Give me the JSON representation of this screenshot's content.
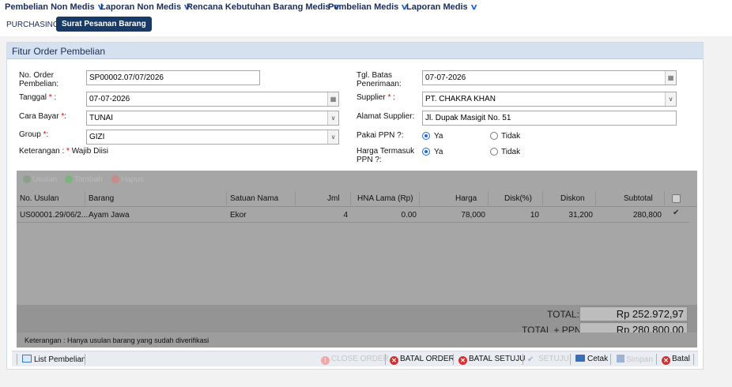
{
  "menu": [
    {
      "label": "Pembelian Non Medis"
    },
    {
      "label": "Laporan Non Medis"
    },
    {
      "label": "Rencana Kebutuhan Barang Medis"
    },
    {
      "label": "Pembelian Medis"
    },
    {
      "label": "Laporan Medis"
    }
  ],
  "breadcrumb": {
    "section": "PURCHASING",
    "active": "Surat Pesanan Barang"
  },
  "panel": {
    "title": "Fitur Order Pembelian"
  },
  "form": {
    "no_order_label": "No. Order Pembelian:",
    "no_order_value": "SP00002.07/07/2026",
    "tanggal_label": "Tanggal",
    "tanggal_value": "07-07-2026",
    "cara_bayar_label": "Cara Bayar",
    "cara_bayar_value": "TUNAI",
    "group_label": "Group",
    "group_value": "GIZI",
    "keterangan_label": "Keterangan :",
    "wajib_text": "Wajib Diisi",
    "tgl_batas_label": "Tgl. Batas Penerimaan:",
    "tgl_batas_value": "07-07-2026",
    "supplier_label": "Supplier",
    "supplier_value": "PT. CHAKRA KHAN",
    "alamat_label": "Alamat Supplier:",
    "alamat_value": "Jl. Dupak Masigit No. 51",
    "ppn_label": "Pakai PPN ?:",
    "harga_ppn_label": "Harga Termasuk PPN ?:",
    "ya": "Ya",
    "tidak": "Tidak",
    "asterisk": "*",
    "colon": " :",
    "colon_short": ":"
  },
  "grid": {
    "toolbar": [
      "Usulan",
      "Tambah",
      "Hapus"
    ],
    "columns": [
      "No. Usulan",
      "Barang",
      "Satuan Nama",
      "Jml",
      "HNA Lama (Rp)",
      "Harga",
      "Disk(%)",
      "Diskon",
      "Subtotal"
    ],
    "rows": [
      {
        "no_usulan": "US00001.29/06/2...",
        "barang": "Ayam Jawa",
        "satuan": "Ekor",
        "jml": "4",
        "hna": "0.00",
        "harga": "78,000",
        "disk": "10",
        "diskon": "31,200",
        "subtotal": "280,800",
        "checked": true
      }
    ]
  },
  "totals": {
    "total_label": "TOTAL:",
    "total_value": "Rp 252.972,97",
    "total_ppn_label": "TOTAL + PPN:",
    "total_ppn_value": "Rp 280.800,00"
  },
  "note": "Keterangan : Hanya usulan barang yang sudah diverifikasi",
  "actions": {
    "list": "List Pembelian",
    "close_order": "CLOSE ORDER",
    "batal_order": "BATAL ORDER",
    "batal_setuju": "BATAL SETUJU",
    "setuju": "SETUJU",
    "cetak": "Cetak",
    "simpan": "Simpan",
    "batal": "Batal"
  }
}
